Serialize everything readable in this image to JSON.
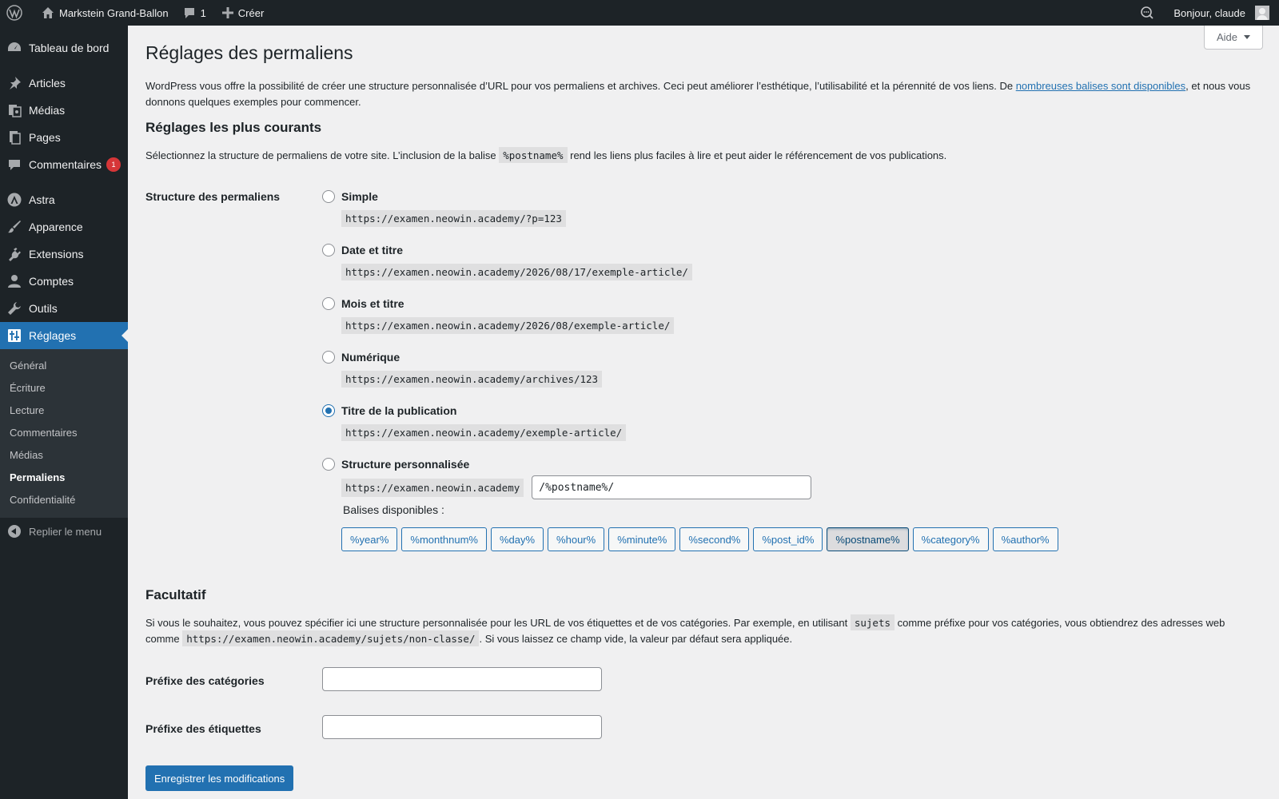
{
  "adminbar": {
    "site_name": "Markstein Grand-Ballon",
    "comments_count": "1",
    "new_label": "Créer",
    "greeting": "Bonjour, claude"
  },
  "sidebar": {
    "items": [
      {
        "label": "Tableau de bord",
        "icon": "dashboard-icon"
      },
      {
        "label": "Articles",
        "icon": "pin-icon"
      },
      {
        "label": "Médias",
        "icon": "media-icon"
      },
      {
        "label": "Pages",
        "icon": "pages-icon"
      },
      {
        "label": "Commentaires",
        "icon": "comments-icon",
        "badge": "1"
      },
      {
        "label": "Astra",
        "icon": "astra-icon"
      },
      {
        "label": "Apparence",
        "icon": "brush-icon"
      },
      {
        "label": "Extensions",
        "icon": "plugin-icon"
      },
      {
        "label": "Comptes",
        "icon": "user-icon"
      },
      {
        "label": "Outils",
        "icon": "wrench-icon"
      },
      {
        "label": "Réglages",
        "icon": "settings-icon",
        "current": true
      }
    ],
    "submenu": [
      "Général",
      "Écriture",
      "Lecture",
      "Commentaires",
      "Médias",
      "Permaliens",
      "Confidentialité"
    ],
    "collapse_label": "Replier le menu"
  },
  "help_label": "Aide",
  "page_title": "Réglages des permaliens",
  "intro": {
    "before_link": "WordPress vous offre la possibilité de créer une structure personnalisée d’URL pour vos permaliens et archives. Ceci peut améliorer l’esthétique, l’utilisabilité et la pérennité de vos liens. De ",
    "link": "nombreuses balises sont disponibles",
    "after_link": ", et nous vous donnons quelques exemples pour commencer."
  },
  "common": {
    "heading": "Réglages les plus courants",
    "desc_before": "Sélectionnez la structure de permaliens de votre site. L’inclusion de la balise ",
    "desc_code": "%postname%",
    "desc_after": " rend les liens plus faciles à lire et peut aider le référencement de vos publications.",
    "row_label": "Structure des permaliens",
    "options": [
      {
        "label": "Simple",
        "example": "https://examen.neowin.academy/?p=123",
        "checked": false
      },
      {
        "label": "Date et titre",
        "example": "https://examen.neowin.academy/2026/08/17/exemple-article/",
        "checked": false
      },
      {
        "label": "Mois et titre",
        "example": "https://examen.neowin.academy/2026/08/exemple-article/",
        "checked": false
      },
      {
        "label": "Numérique",
        "example": "https://examen.neowin.academy/archives/123",
        "checked": false
      },
      {
        "label": "Titre de la publication",
        "example": "https://examen.neowin.academy/exemple-article/",
        "checked": true
      }
    ],
    "custom": {
      "label": "Structure personnalisée",
      "base": "https://examen.neowin.academy",
      "value": "/%postname%/",
      "tags_label": "Balises disponibles :",
      "tags": [
        "%year%",
        "%monthnum%",
        "%day%",
        "%hour%",
        "%minute%",
        "%second%",
        "%post_id%",
        "%postname%",
        "%category%",
        "%author%"
      ],
      "active_tag": "%postname%"
    }
  },
  "optional": {
    "heading": "Facultatif",
    "desc_part1": "Si vous le souhaitez, vous pouvez spécifier ici une structure personnalisée pour les URL de vos étiquettes et de vos catégories. Par exemple, en utilisant ",
    "desc_code1": "sujets",
    "desc_part2": " comme préfixe pour vos catégories, vous obtiendrez des adresses web comme ",
    "desc_code2": "https://examen.neowin.academy/sujets/non-classe/",
    "desc_part3": ". Si vous laissez ce champ vide, la valeur par défaut sera appliquée.",
    "category_label": "Préfixe des catégories",
    "category_value": "",
    "tag_label": "Préfixe des étiquettes",
    "tag_value": ""
  },
  "submit_label": "Enregistrer les modifications",
  "colors": {
    "accent": "#2271b1",
    "adminbar": "#1d2327",
    "badge": "#d63638"
  }
}
